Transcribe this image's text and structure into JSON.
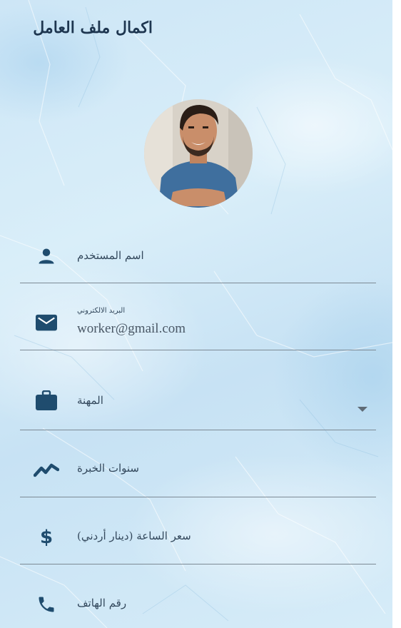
{
  "app": {
    "title": "اكمال ملف العامل",
    "background_color": "#d3eaf7",
    "icon_color": "#1f4c6e"
  },
  "profile": {
    "avatar_icon": "user-photo"
  },
  "form": {
    "username": {
      "label": "اسم المستخدم",
      "icon": "person-icon",
      "value": ""
    },
    "email": {
      "label": "البريد الالكتروني",
      "icon": "mail-icon",
      "value": "worker@gmail.com"
    },
    "profession": {
      "label": "المهنة",
      "icon": "briefcase-icon",
      "selected": ""
    },
    "experience": {
      "label": "سنوات الخبرة",
      "icon": "trending-icon",
      "value": ""
    },
    "hourly_rate": {
      "label": "سعر الساعة (دينار أردني)",
      "icon": "dollar-icon",
      "value": ""
    },
    "phone": {
      "label": "رقم الهاتف",
      "icon": "phone-icon",
      "value": ""
    }
  }
}
